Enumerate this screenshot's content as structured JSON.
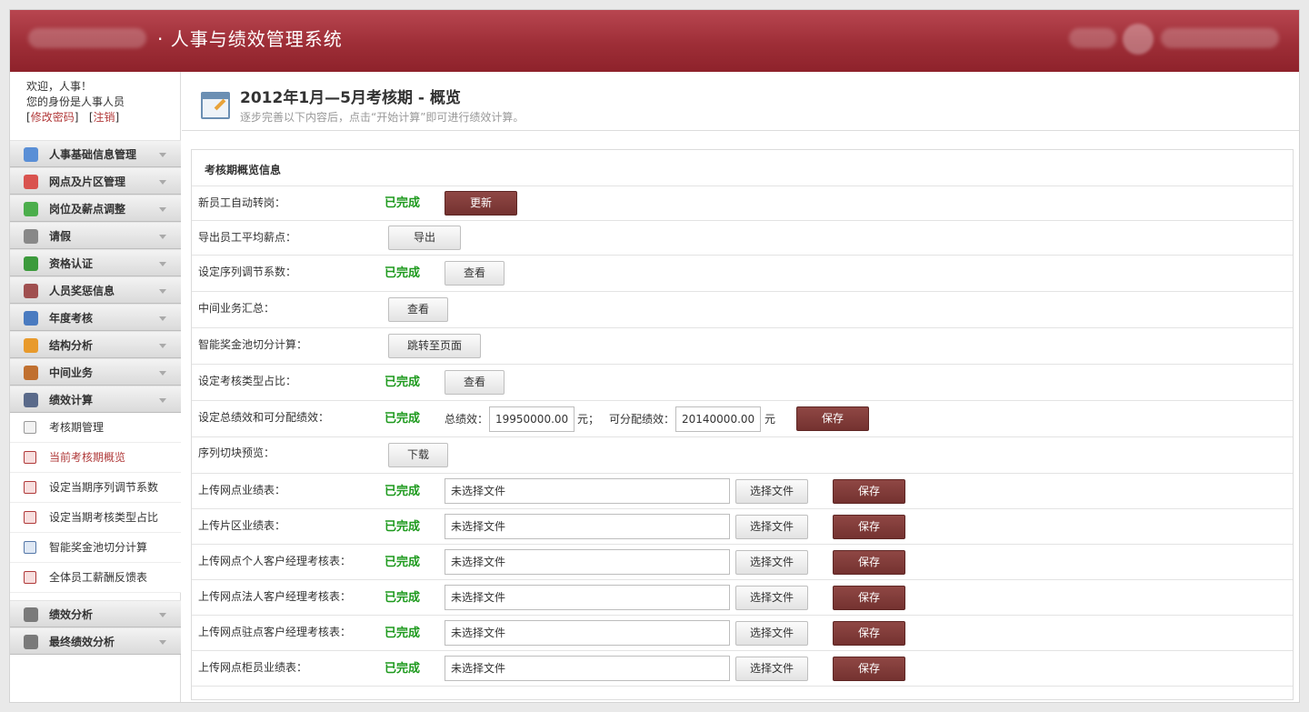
{
  "header": {
    "blurred_org_name": "成都分行",
    "title": "· 人事与绩效管理系统",
    "brand_blurred": "ICBC 中国工商银行"
  },
  "user": {
    "welcome": "欢迎，人事！",
    "role_text": "您的身份是人事人员",
    "change_password": "修改密码",
    "logout": "注销"
  },
  "sidebar": {
    "categories_top": [
      {
        "label": "人事基础信息管理",
        "icon": "user-icon",
        "color": "#5a8fd6"
      },
      {
        "label": "网点及片区管理",
        "icon": "network-icon",
        "color": "#d9534f"
      },
      {
        "label": "岗位及薪点调整",
        "icon": "chart-icon",
        "color": "#4cae4c"
      },
      {
        "label": "请假",
        "icon": "pen-icon",
        "color": "#888888"
      },
      {
        "label": "资格认证",
        "icon": "tag-icon",
        "color": "#3c9a3c"
      },
      {
        "label": "人员奖惩信息",
        "icon": "book-icon",
        "color": "#a05050"
      },
      {
        "label": "年度考核",
        "icon": "graph-icon",
        "color": "#4a7bc0"
      },
      {
        "label": "结构分析",
        "icon": "pie-icon",
        "color": "#e89a2c"
      },
      {
        "label": "中间业务",
        "icon": "coins-icon",
        "color": "#c07030"
      },
      {
        "label": "绩效计算",
        "icon": "calculator-icon",
        "color": "#5a6a8a"
      }
    ],
    "subitems": [
      {
        "label": "考核期管理",
        "active": false
      },
      {
        "label": "当前考核期概览",
        "active": true
      },
      {
        "label": "设定当期序列调节系数",
        "active": false
      },
      {
        "label": "设定当期考核类型占比",
        "active": false
      },
      {
        "label": "智能奖金池切分计算",
        "active": false
      },
      {
        "label": "全体员工薪酬反馈表",
        "active": false
      }
    ],
    "categories_bottom": [
      {
        "label": "绩效分析",
        "icon": "list-icon",
        "color": "#7a7a7a"
      },
      {
        "label": "最终绩效分析",
        "icon": "list-icon",
        "color": "#7a7a7a"
      }
    ]
  },
  "page": {
    "title": "2012年1月—5月考核期 - 概览",
    "description": "逐步完善以下内容后，点击“开始计算”即可进行绩效计算。"
  },
  "panel": {
    "title": "考核期概览信息",
    "status_done": "已完成",
    "rows": {
      "r1": {
        "label": "新员工自动转岗：",
        "button": "更新"
      },
      "r2": {
        "label": "导出员工平均薪点：",
        "button": "导出"
      },
      "r3": {
        "label": "设定序列调节系数：",
        "button": "查看"
      },
      "r4": {
        "label": "中间业务汇总：",
        "button": "查看"
      },
      "r5": {
        "label": "智能奖金池切分计算：",
        "button": "跳转至页面"
      },
      "r6": {
        "label": "设定考核类型占比：",
        "button": "查看"
      },
      "r7": {
        "label": "设定总绩效和可分配绩效：",
        "total_label": "总绩效：",
        "total_value": "19950000.00",
        "unit_a": "元；",
        "alloc_label": "可分配绩效：",
        "alloc_value": "20140000.00",
        "unit_b": "元",
        "button": "保存"
      },
      "r8": {
        "label": "序列切块预览：",
        "button": "下载"
      }
    },
    "uploads": [
      {
        "label": "上传网点业绩表：",
        "file": "未选择文件",
        "choose": "选择文件",
        "save": "保存"
      },
      {
        "label": "上传片区业绩表：",
        "file": "未选择文件",
        "choose": "选择文件",
        "save": "保存"
      },
      {
        "label": "上传网点个人客户经理考核表：",
        "file": "未选择文件",
        "choose": "选择文件",
        "save": "保存"
      },
      {
        "label": "上传网点法人客户经理考核表：",
        "file": "未选择文件",
        "choose": "选择文件",
        "save": "保存"
      },
      {
        "label": "上传网点驻点客户经理考核表：",
        "file": "未选择文件",
        "choose": "选择文件",
        "save": "保存"
      },
      {
        "label": "上传网点柜员业绩表：",
        "file": "未选择文件",
        "choose": "选择文件",
        "save": "保存"
      }
    ]
  },
  "colors": {
    "header": "#a8343e",
    "status_green": "#1e9a1e",
    "button_red": "#7f3a38",
    "active_link": "#b03a3a"
  }
}
